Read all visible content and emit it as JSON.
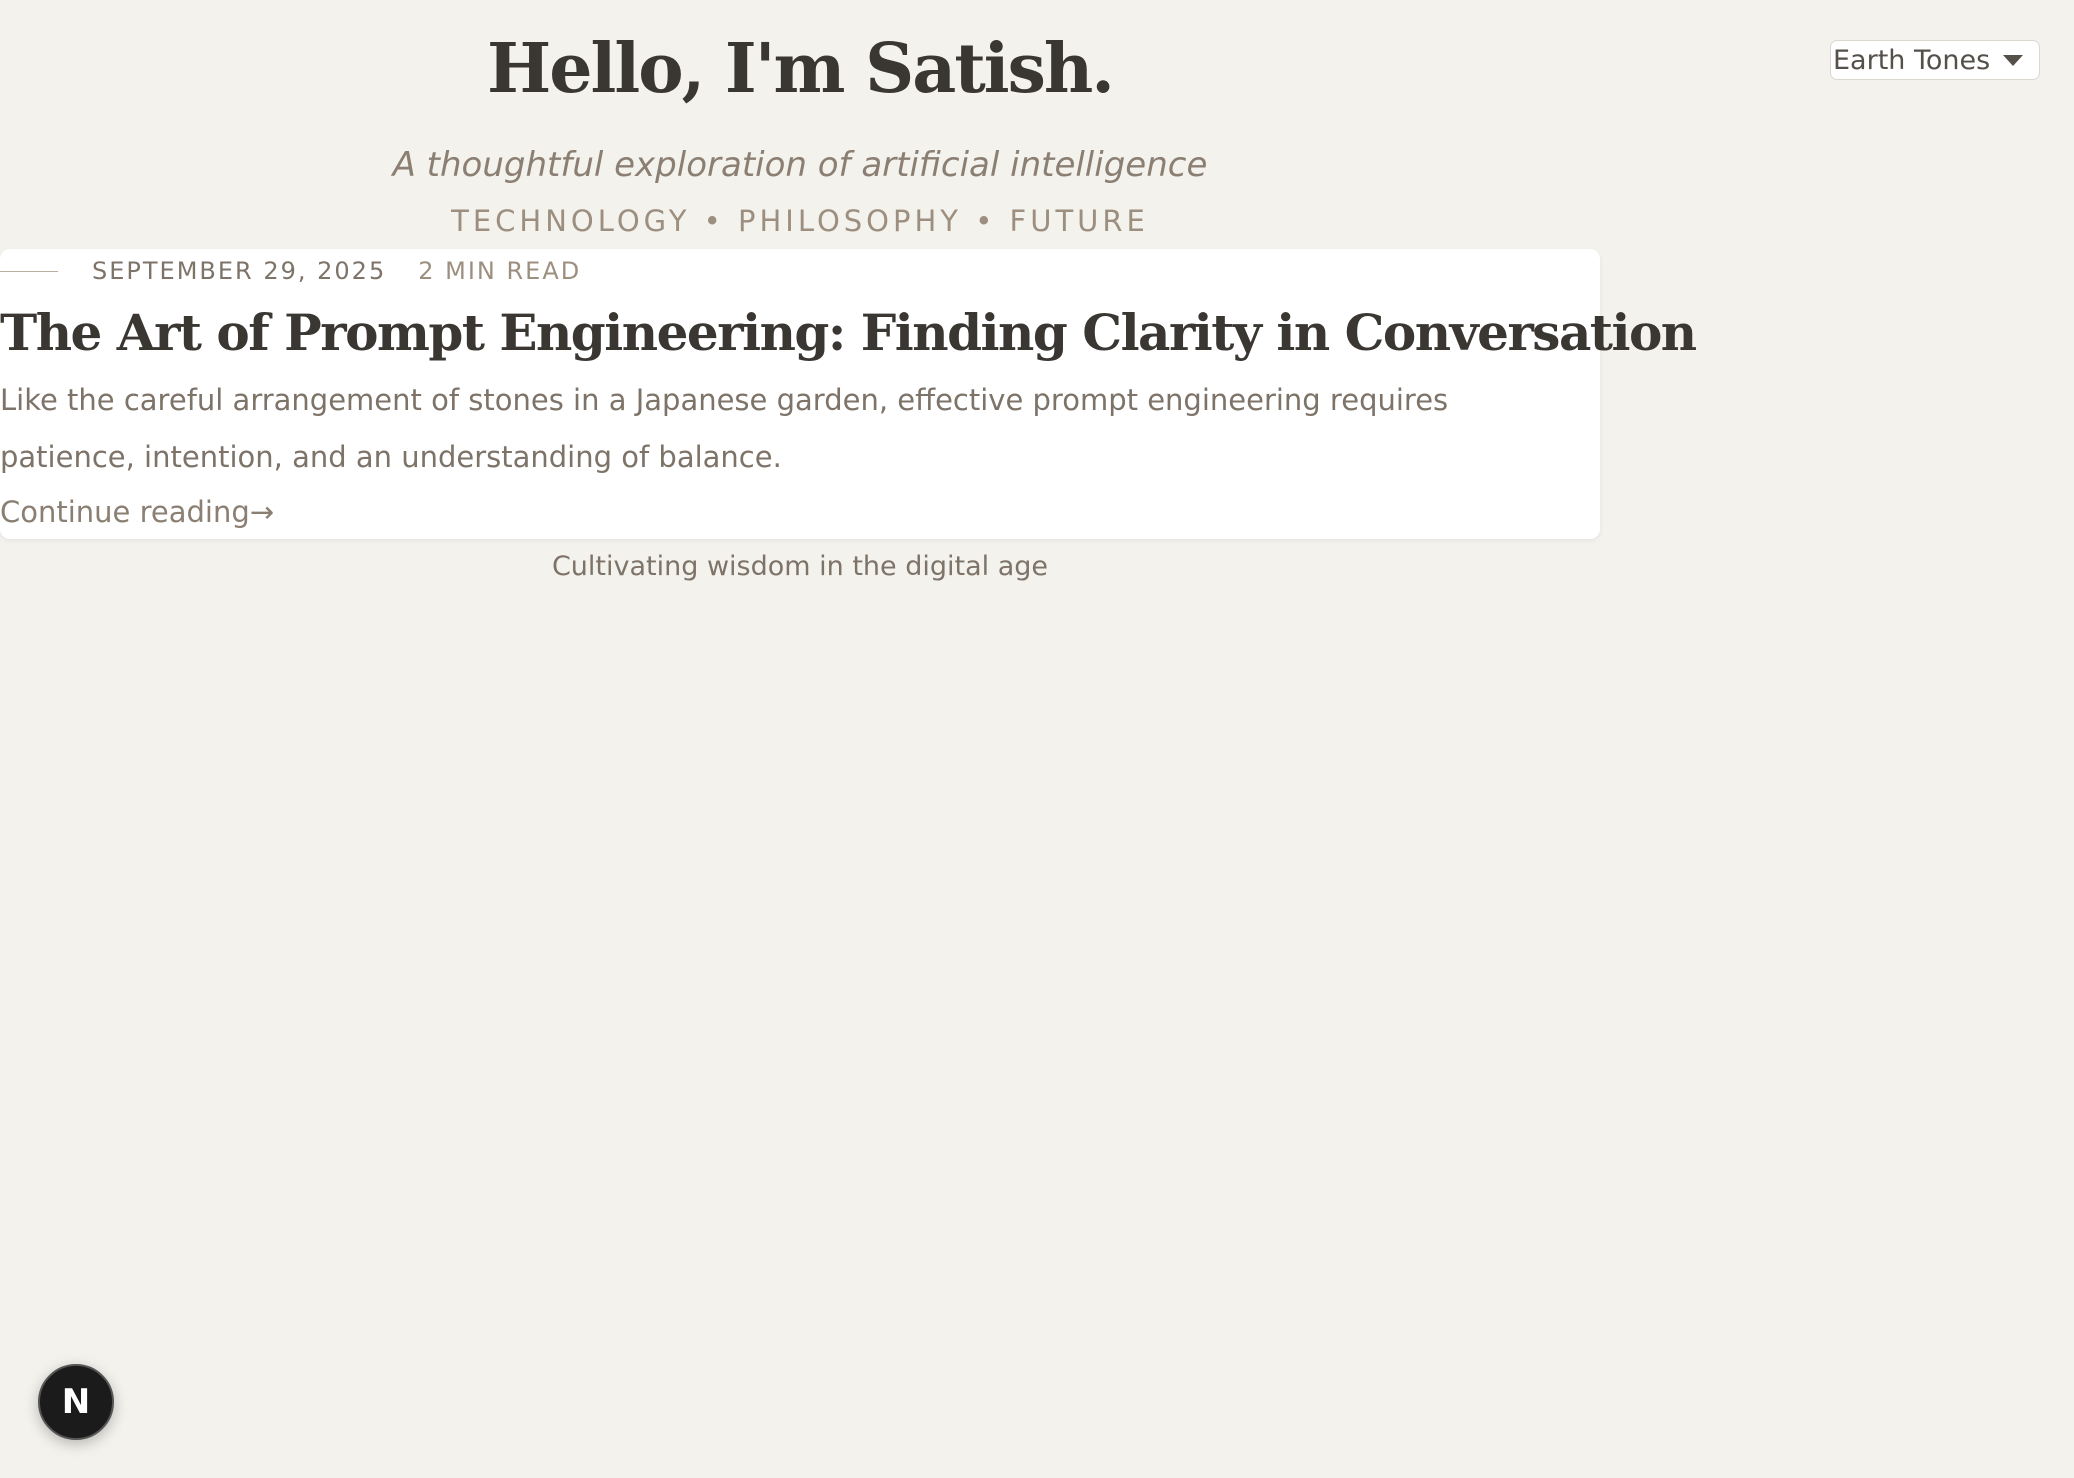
{
  "header": {
    "title": "Hello, I'm Satish.",
    "tagline": "A thoughtful exploration of artificial intelligence",
    "topics": "TECHNOLOGY • PHILOSOPHY • FUTURE"
  },
  "theme_selector": {
    "selected": "Earth Tones",
    "icon": "chevron-down-icon"
  },
  "post": {
    "date": "SEPTEMBER 29, 2025",
    "read_time": "2 MIN READ",
    "title": "The Art of Prompt Engineering: Finding Clarity in Conversation",
    "excerpt": "Like the careful arrangement of stones in a Japanese garden, effective prompt engineering requires patience, intention, and an understanding of balance.",
    "continue_label": "Continue reading→"
  },
  "footer": {
    "note": "Cultivating wisdom in the digital age"
  },
  "dev_badge": {
    "letter": "N"
  },
  "colors": {
    "background": "#f4f2ed",
    "card": "#ffffff",
    "heading": "#3a3733",
    "muted": "#7d7368",
    "accent": "#9c8f80"
  }
}
